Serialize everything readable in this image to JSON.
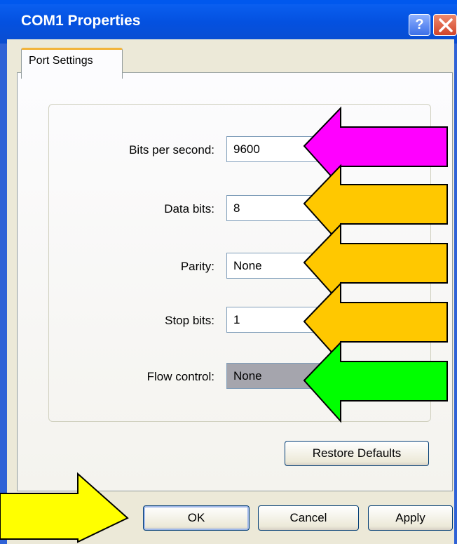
{
  "window": {
    "title": "COM1 Properties",
    "help_label": "?"
  },
  "tabs": [
    {
      "label": "Port Settings",
      "selected": true
    }
  ],
  "fields": [
    {
      "label": "Bits per second:",
      "value": "9600",
      "enabled": true
    },
    {
      "label": "Data bits:",
      "value": "8",
      "enabled": true
    },
    {
      "label": "Parity:",
      "value": "None",
      "enabled": true
    },
    {
      "label": "Stop bits:",
      "value": "1",
      "enabled": true
    },
    {
      "label": "Flow control:",
      "value": "None",
      "enabled": true,
      "highlighted": true
    }
  ],
  "buttons": {
    "restore_defaults": "Restore Defaults",
    "ok": "OK",
    "cancel": "Cancel",
    "apply": "Apply"
  },
  "annotations": {
    "arrow_colors": [
      "#ff00ff",
      "#ffc800",
      "#ffc800",
      "#ffc800",
      "#00ff00",
      "#ffff00"
    ]
  },
  "colors": {
    "titlebar": "#0451e0",
    "dialog_bg": "#ece9d8",
    "tab_accent": "#f2b43b"
  }
}
